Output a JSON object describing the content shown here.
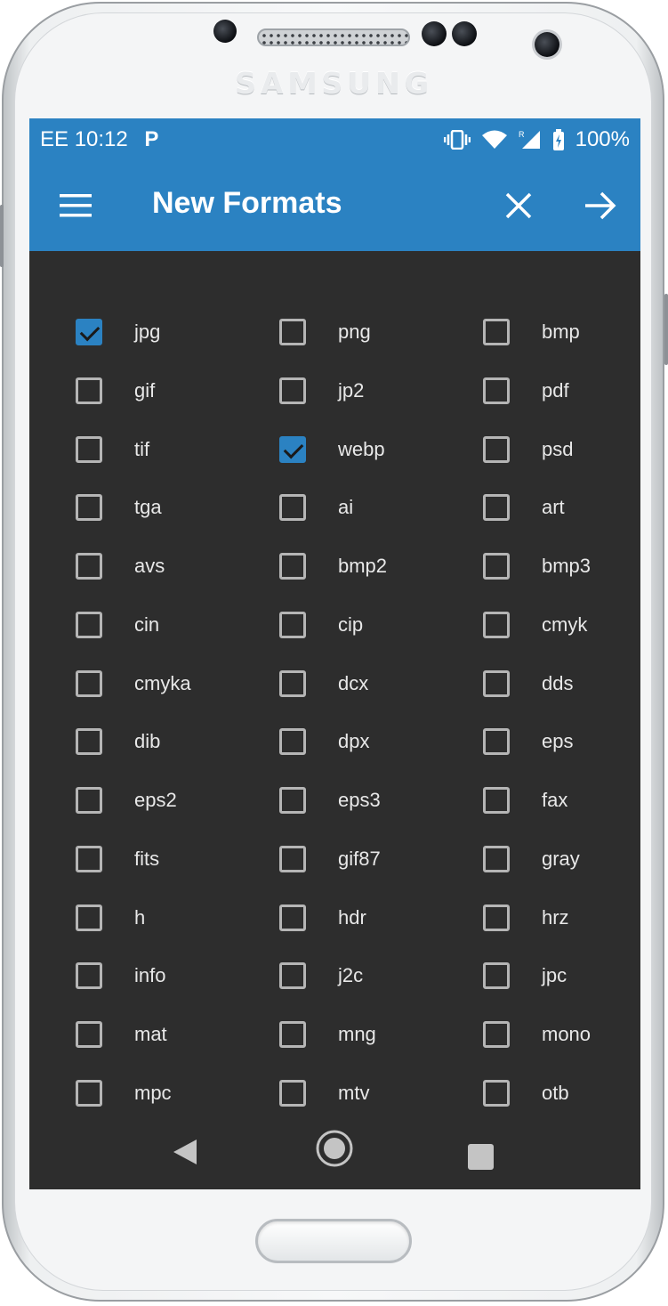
{
  "device": {
    "brand": "SAMSUNG"
  },
  "statusbar": {
    "carrier": "EE",
    "time": "10:12",
    "app_icon": "P",
    "battery": "100%",
    "icons": [
      "vibrate-icon",
      "wifi-icon",
      "signal-icon",
      "battery-icon"
    ]
  },
  "toolbar": {
    "title": "New Formats",
    "menu_icon": "hamburger-menu-icon",
    "close_icon": "close-icon",
    "next_icon": "arrow-right-icon"
  },
  "formats": [
    {
      "label": "jpg",
      "checked": true
    },
    {
      "label": "png",
      "checked": false
    },
    {
      "label": "bmp",
      "checked": false
    },
    {
      "label": "gif",
      "checked": false
    },
    {
      "label": "jp2",
      "checked": false
    },
    {
      "label": "pdf",
      "checked": false
    },
    {
      "label": "tif",
      "checked": false
    },
    {
      "label": "webp",
      "checked": true
    },
    {
      "label": "psd",
      "checked": false
    },
    {
      "label": "tga",
      "checked": false
    },
    {
      "label": "ai",
      "checked": false
    },
    {
      "label": "art",
      "checked": false
    },
    {
      "label": "avs",
      "checked": false
    },
    {
      "label": "bmp2",
      "checked": false
    },
    {
      "label": "bmp3",
      "checked": false
    },
    {
      "label": "cin",
      "checked": false
    },
    {
      "label": "cip",
      "checked": false
    },
    {
      "label": "cmyk",
      "checked": false
    },
    {
      "label": "cmyka",
      "checked": false
    },
    {
      "label": "dcx",
      "checked": false
    },
    {
      "label": "dds",
      "checked": false
    },
    {
      "label": "dib",
      "checked": false
    },
    {
      "label": "dpx",
      "checked": false
    },
    {
      "label": "eps",
      "checked": false
    },
    {
      "label": "eps2",
      "checked": false
    },
    {
      "label": "eps3",
      "checked": false
    },
    {
      "label": "fax",
      "checked": false
    },
    {
      "label": "fits",
      "checked": false
    },
    {
      "label": "gif87",
      "checked": false
    },
    {
      "label": "gray",
      "checked": false
    },
    {
      "label": "h",
      "checked": false
    },
    {
      "label": "hdr",
      "checked": false
    },
    {
      "label": "hrz",
      "checked": false
    },
    {
      "label": "info",
      "checked": false
    },
    {
      "label": "j2c",
      "checked": false
    },
    {
      "label": "jpc",
      "checked": false
    },
    {
      "label": "mat",
      "checked": false
    },
    {
      "label": "mng",
      "checked": false
    },
    {
      "label": "mono",
      "checked": false
    },
    {
      "label": "mpc",
      "checked": false
    },
    {
      "label": "mtv",
      "checked": false
    },
    {
      "label": "otb",
      "checked": false
    }
  ],
  "navbar": {
    "back_icon": "back-triangle-icon",
    "home_icon": "home-circle-icon",
    "recents_icon": "recents-square-icon"
  },
  "colors": {
    "accent": "#2b82c2",
    "background": "#2d2d2d",
    "text": "#e8e8e8",
    "checkbox_border": "#b5b5b5"
  }
}
